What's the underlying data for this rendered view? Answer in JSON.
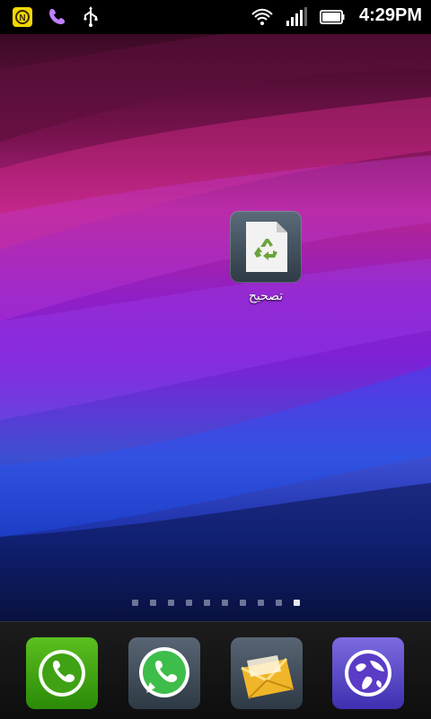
{
  "status_bar": {
    "time": "4:29PM",
    "icons": [
      "notification-n-icon",
      "viber-icon",
      "usb-icon",
      "wifi-icon",
      "signal-icon",
      "battery-icon"
    ]
  },
  "home": {
    "app": {
      "label": "تصحيح",
      "icon": "recycle-file-icon"
    },
    "page_count": 10,
    "active_page_index": 9
  },
  "dock": {
    "items": [
      {
        "name": "phone",
        "icon": "phone-icon"
      },
      {
        "name": "whatsapp",
        "icon": "whatsapp-icon"
      },
      {
        "name": "messages",
        "icon": "messages-icon"
      },
      {
        "name": "browser",
        "icon": "globe-icon"
      }
    ]
  }
}
